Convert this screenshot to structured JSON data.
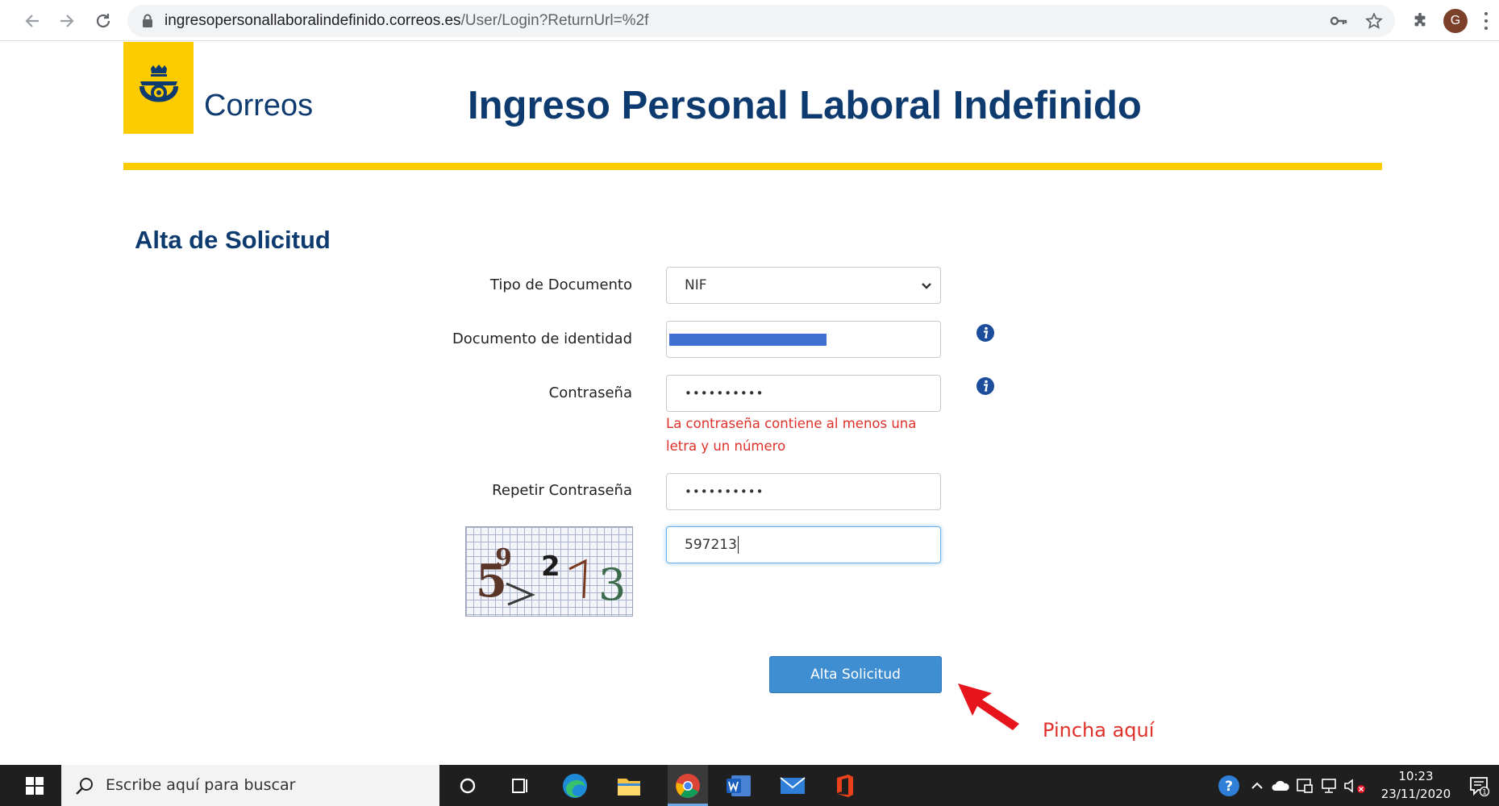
{
  "browser": {
    "url_host": "ingresopersonallaboralindefinido.correos.es",
    "url_path": "/User/Login?ReturnUrl=%2f",
    "profile_initial": "G"
  },
  "header": {
    "logo_text": "Correos",
    "title": "Ingreso Personal Laboral Indefinido",
    "brand_yellow": "#fdcc00",
    "brand_blue": "#0e3b6f"
  },
  "form": {
    "section_title": "Alta de Solicitud",
    "tipo_documento": {
      "label": "Tipo de Documento",
      "value": "NIF"
    },
    "documento": {
      "label": "Documento de identidad"
    },
    "contrasena": {
      "label": "Contraseña",
      "value": "••••••••••",
      "error": "La contraseña contiene al menos una letra y un número"
    },
    "repetir": {
      "label": "Repetir Contraseña",
      "value": "••••••••••"
    },
    "captcha_input": {
      "value": "597213"
    },
    "captcha_image": {
      "digits": [
        "5",
        "9",
        "2",
        "1",
        "3"
      ]
    },
    "submit_label": "Alta Solicitud"
  },
  "annotation": {
    "text": "Pincha aquí",
    "color": "#e0302a"
  },
  "taskbar": {
    "search_placeholder": "Escribe aquí para buscar",
    "time": "10:23",
    "date": "23/11/2020"
  }
}
